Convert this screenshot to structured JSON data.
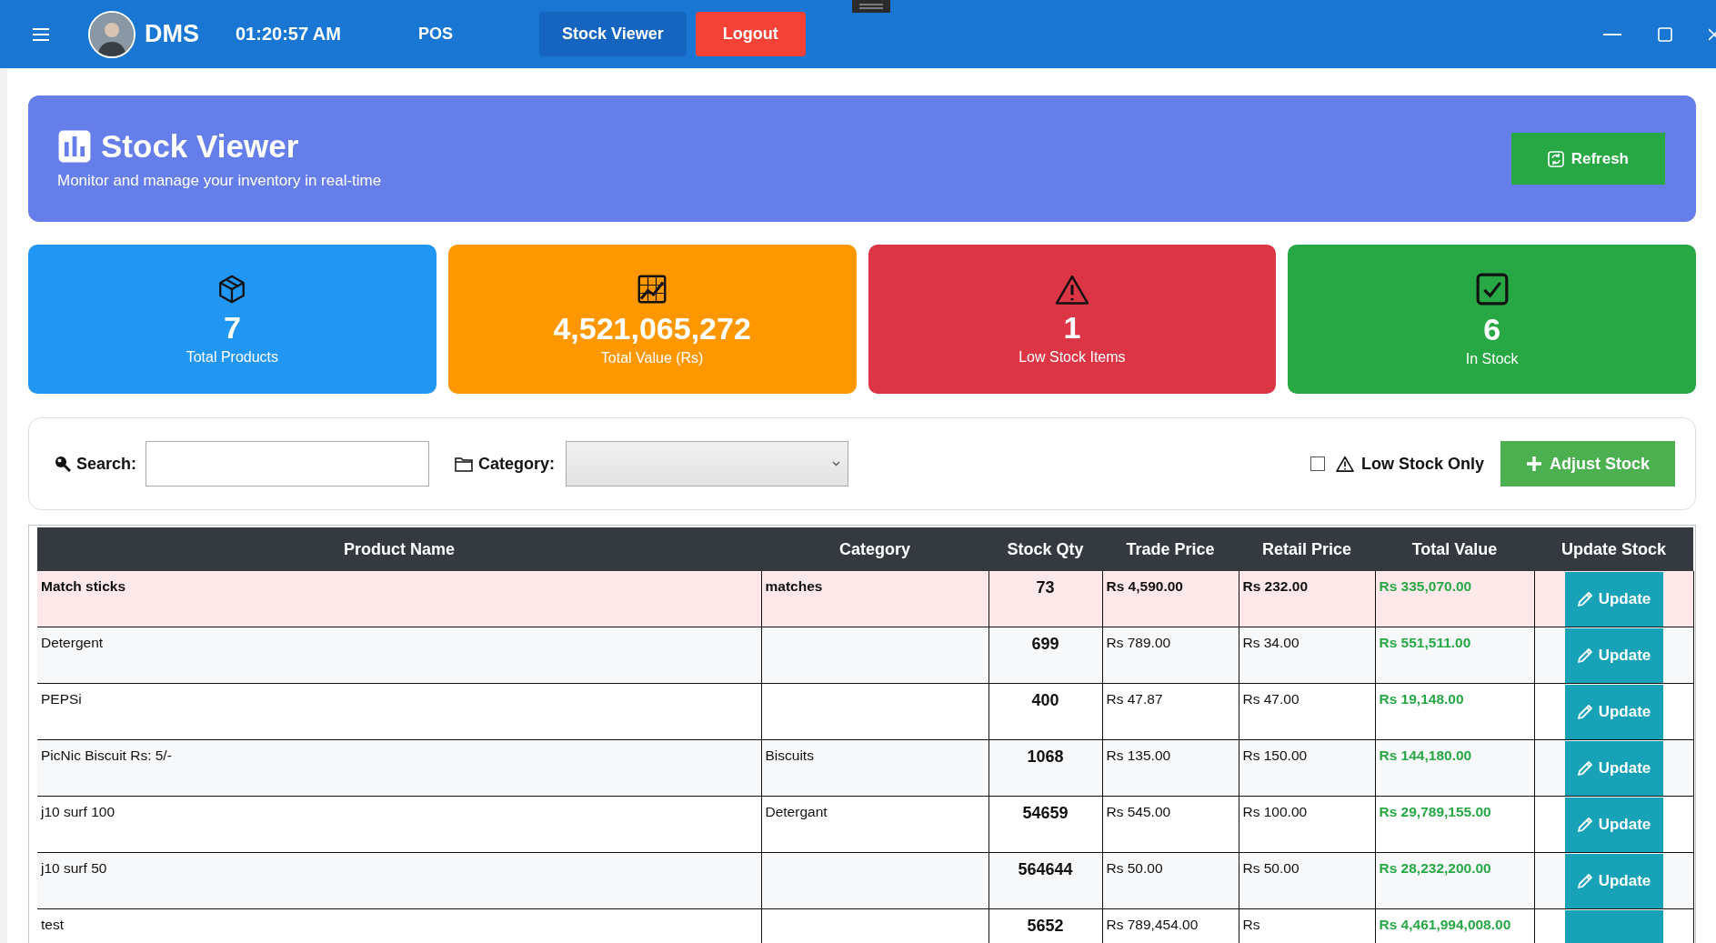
{
  "topbar": {
    "brand": "DMS",
    "clock": "01:20:57 AM",
    "nav": [
      {
        "label": "POS",
        "kind": "link"
      },
      {
        "label": "Stock Viewer",
        "kind": "active"
      },
      {
        "label": "Logout",
        "kind": "danger"
      }
    ]
  },
  "header": {
    "title": "Stock Viewer",
    "subtitle": "Monitor and manage your inventory in real-time",
    "refresh": "Refresh"
  },
  "stats": [
    {
      "value": "7",
      "label": "Total Products",
      "kind": "products",
      "color": "#2196f3"
    },
    {
      "value": "4,521,065,272",
      "label": "Total Value (Rs)",
      "kind": "value",
      "color": "#ff9800"
    },
    {
      "value": "1",
      "label": "Low Stock Items",
      "kind": "low",
      "color": "#dc3545"
    },
    {
      "value": "6",
      "label": "In Stock",
      "kind": "instock",
      "color": "#28a745"
    }
  ],
  "filters": {
    "search_label": "Search:",
    "category_label": "Category:",
    "low_stock_only": {
      "label": "Low Stock Only",
      "checked": false
    },
    "adjust": "Adjust Stock"
  },
  "table": {
    "columns": [
      "Product Name",
      "Category",
      "Stock Qty",
      "Trade Price",
      "Retail Price",
      "Total Value",
      "Update Stock"
    ],
    "rows": [
      {
        "name": "Match sticks",
        "category": "matches",
        "qty": "73",
        "trade": "Rs 4,590.00",
        "retail": "Rs 232.00",
        "total": "Rs 335,070.00",
        "action": "Update",
        "low_stock": true
      },
      {
        "name": "Detergent",
        "category": "",
        "qty": "699",
        "trade": "Rs 789.00",
        "retail": "Rs 34.00",
        "total": "Rs 551,511.00",
        "action": "Update",
        "low_stock": false
      },
      {
        "name": "PEPSi",
        "category": "",
        "qty": "400",
        "trade": "Rs 47.87",
        "retail": "Rs 47.00",
        "total": "Rs 19,148.00",
        "action": "Update",
        "low_stock": false
      },
      {
        "name": "PicNic Biscuit Rs: 5/-",
        "category": "Biscuits",
        "qty": "1068",
        "trade": "Rs 135.00",
        "retail": "Rs 150.00",
        "total": "Rs 144,180.00",
        "action": "Update",
        "low_stock": false
      },
      {
        "name": "j10 surf 100",
        "category": "Detergant",
        "qty": "54659",
        "trade": "Rs 545.00",
        "retail": "Rs 100.00",
        "total": "Rs 29,789,155.00",
        "action": "Update",
        "low_stock": false
      },
      {
        "name": "j10 surf 50",
        "category": "",
        "qty": "564644",
        "trade": "Rs 50.00",
        "retail": "Rs 50.00",
        "total": "Rs 28,232,200.00",
        "action": "Update",
        "low_stock": false
      },
      {
        "name": "test",
        "category": "",
        "qty": "5652",
        "trade": "Rs 789,454.00",
        "retail": "Rs",
        "total": "Rs 4,461,994,008.00",
        "low_stock": false
      }
    ]
  }
}
